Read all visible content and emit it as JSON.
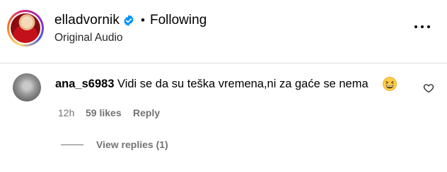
{
  "header": {
    "username": "elladvornik",
    "separator": "•",
    "follow_status": "Following",
    "audio_label": "Original Audio",
    "verified_color": "#0095f6",
    "more_icon": "more-horizontal-icon"
  },
  "comment": {
    "username": "ana_s6983",
    "text": "Vidi se da su teška vremena,ni za gaće se nema",
    "emoji": "grinning-squinting-face",
    "time": "12h",
    "likes": "59 likes",
    "reply_label": "Reply",
    "view_replies_label": "View replies (1)",
    "heart_icon": "heart-outline-icon"
  }
}
